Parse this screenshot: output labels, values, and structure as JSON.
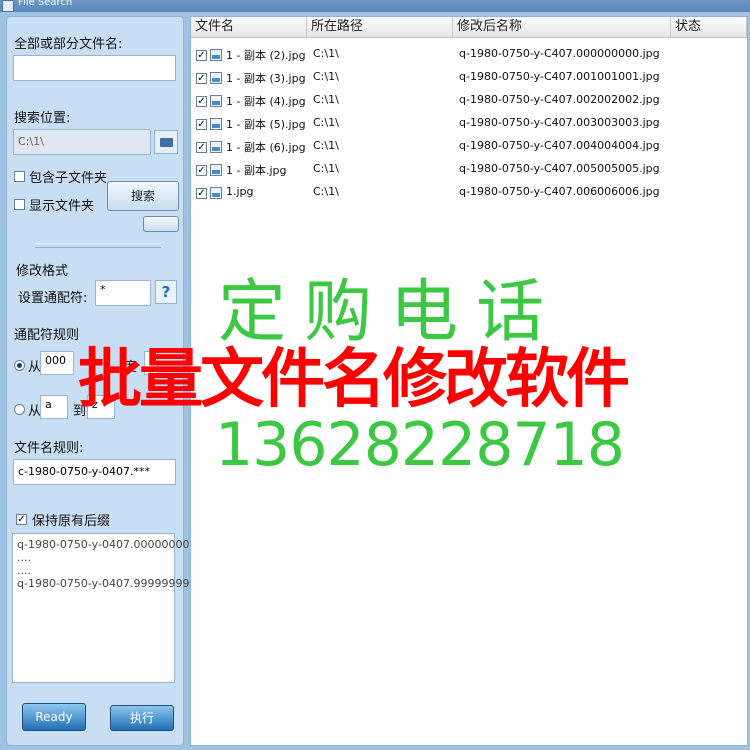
{
  "window": {
    "title": "File Search"
  },
  "left": {
    "name_label": "全部或部分文件名:",
    "name_value": "",
    "location_label": "搜索位置:",
    "location_value": "C:\\1\\",
    "include_subfolders_label": "包含子文件夹",
    "show_folders_label": "显示文件夹",
    "search_button": "搜索",
    "format_section": "修改格式",
    "wildcard_label": "设置通配符:",
    "wildcard_value": "*",
    "help_button": "?",
    "rule_section": "通配符规则",
    "from_label_1": "从",
    "from_value_1": "000",
    "step_label": "度",
    "step_value": "5",
    "from_label_2": "从",
    "from_value_2": "a",
    "to_label_2": "到",
    "to_value_2": "z",
    "filename_rule_label": "文件名规则:",
    "filename_rule_value": "c-1980-0750-y-0407.***",
    "keep_ext_label": "保持原有后缀",
    "preview_lines": [
      "q-1980-0750-y-0407.000000000",
      "....",
      "....",
      "q-1980-0750-y-0407.999999999"
    ],
    "ready_button": "Ready",
    "execute_button": "执行"
  },
  "table": {
    "columns": [
      "文件名",
      "所在路径",
      "修改后名称",
      "状态"
    ],
    "rows": [
      {
        "name": "1 - 副本 (2).jpg",
        "path": "C:\\1\\",
        "new_name": "q-1980-0750-y-C407.000000000.jpg",
        "status": ""
      },
      {
        "name": "1 - 副本 (3).jpg",
        "path": "C:\\1\\",
        "new_name": "q-1980-0750-y-C407.001001001.jpg",
        "status": ""
      },
      {
        "name": "1 - 副本 (4).jpg",
        "path": "C:\\1\\",
        "new_name": "q-1980-0750-y-C407.002002002.jpg",
        "status": ""
      },
      {
        "name": "1 - 副本 (5).jpg",
        "path": "C:\\1\\",
        "new_name": "q-1980-0750-y-C407.003003003.jpg",
        "status": ""
      },
      {
        "name": "1 - 副本 (6).jpg",
        "path": "C:\\1\\",
        "new_name": "q-1980-0750-y-C407.004004004.jpg",
        "status": ""
      },
      {
        "name": "1 - 副本.jpg",
        "path": "C:\\1\\",
        "new_name": "q-1980-0750-y-C407.005005005.jpg",
        "status": ""
      },
      {
        "name": "1.jpg",
        "path": "C:\\1\\",
        "new_name": "q-1980-0750-y-C407.006006006.jpg",
        "status": ""
      }
    ]
  },
  "overlay": {
    "phone_label": "定购电话",
    "title": "批量文件名修改软件",
    "phone": "13628228718"
  }
}
